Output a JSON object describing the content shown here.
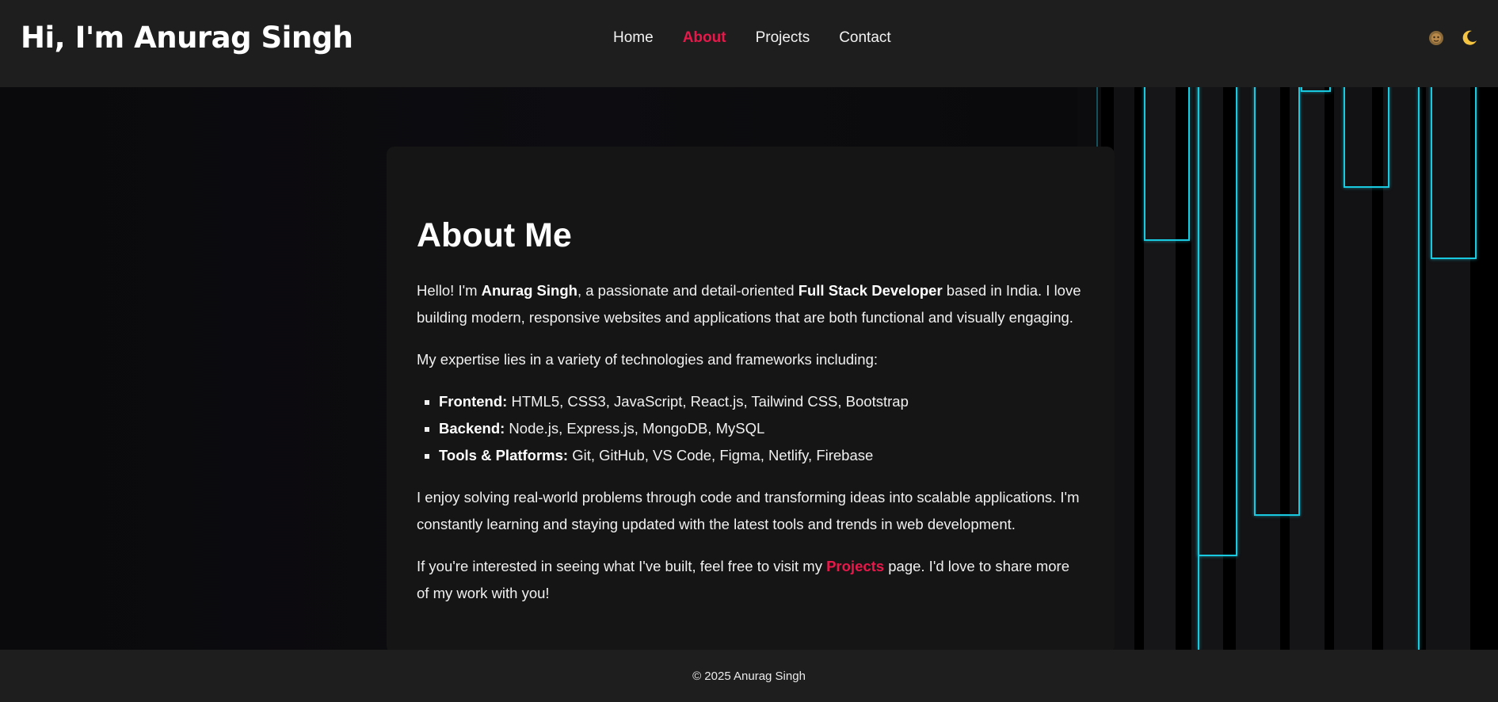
{
  "header": {
    "title": "Hi, I'm Anurag Singh",
    "nav": [
      {
        "label": "Home",
        "active": false
      },
      {
        "label": "About",
        "active": true
      },
      {
        "label": "Projects",
        "active": false
      },
      {
        "label": "Contact",
        "active": false
      }
    ],
    "icons": [
      "avatar-icon",
      "moon-icon"
    ]
  },
  "about": {
    "heading": "About Me",
    "intro": {
      "pre": "Hello! I'm ",
      "name": "Anurag Singh",
      "mid": ", a passionate and detail-oriented ",
      "role": "Full Stack Developer",
      "post": " based in India. I love building modern, responsive websites and applications that are both functional and visually engaging."
    },
    "expertise_lead": "My expertise lies in a variety of technologies and frameworks including:",
    "skills": [
      {
        "label": "Frontend:",
        "value": " HTML5, CSS3, JavaScript, React.js, Tailwind CSS, Bootstrap"
      },
      {
        "label": "Backend:",
        "value": " Node.js, Express.js, MongoDB, MySQL"
      },
      {
        "label": "Tools & Platforms:",
        "value": " Git, GitHub, VS Code, Figma, Netlify, Firebase"
      }
    ],
    "para3": "I enjoy solving real-world problems through code and transforming ideas into scalable applications. I'm constantly learning and staying updated with the latest tools and trends in web development.",
    "para4": {
      "pre": "If you're interested in seeing what I've built, feel free to visit my ",
      "link": "Projects",
      "post": " page. I'd love to share more of my work with you!"
    }
  },
  "footer": {
    "copyright": "© 2025 Anurag Singh"
  },
  "colors": {
    "accent": "#e6194b",
    "neon": "#19c9e0",
    "header_bg": "#1e1e1e",
    "card_bg": "#151515"
  }
}
